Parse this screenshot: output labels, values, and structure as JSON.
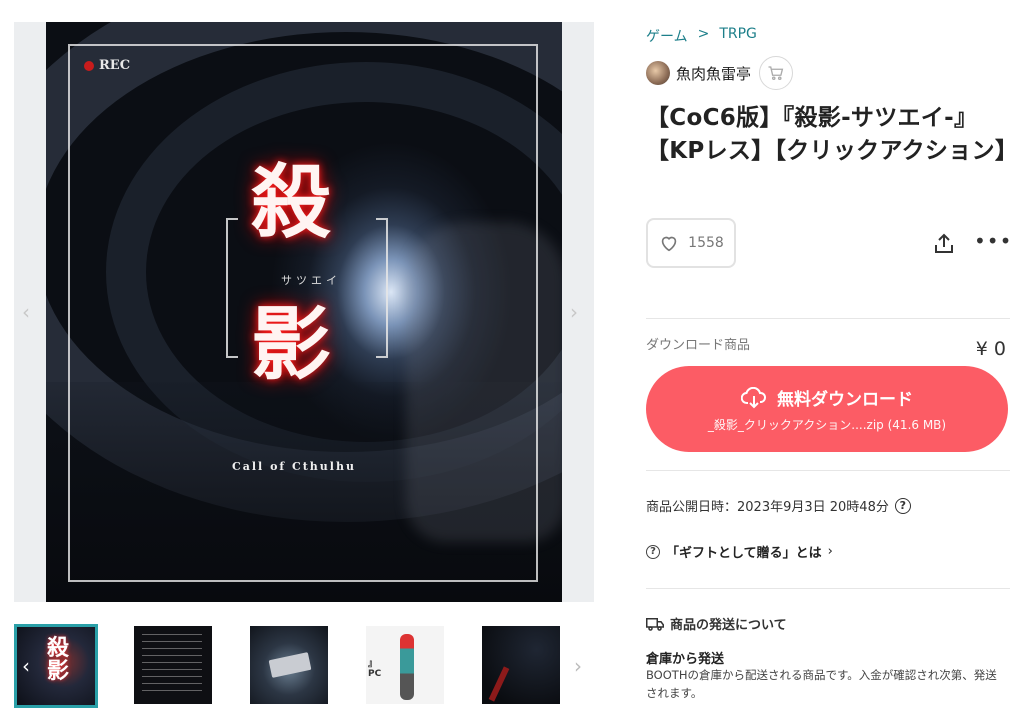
{
  "cover": {
    "rec_label": "REC",
    "kanji_top": "殺",
    "kanji_bottom": "影",
    "subtitle": "サツエイ",
    "game_label": "Call of Cthulhu"
  },
  "breadcrumb": {
    "category": "ゲーム",
    "sub_category": "TRPG"
  },
  "shop": {
    "name": "魚肉魚雷亭"
  },
  "product": {
    "title": "【CoC6版】『殺影-サツエイ-』【KPレス】【クリックアクション】",
    "likes": "1558",
    "type_label": "ダウンロード商品",
    "price": "¥ 0",
    "download_label": "無料ダウンロード",
    "download_file": "_殺影_クリックアクション....zip (41.6 MB)",
    "published": "商品公開日時：2023年9月3日 20時48分",
    "gift_label": "「ギフトとして贈る」とは"
  },
  "shipping": {
    "section_title": "商品の発送について",
    "method": "倉庫から発送",
    "description": "BOOTHの倉庫から配送される商品です。入金が確認され次第、発送されます。"
  },
  "thumbnails": {
    "thumb1_text": "殺\n影",
    "thumb4_text": "』\nPC"
  },
  "colors": {
    "accent": "#1d7f8a",
    "download": "#fc5c65",
    "thumb_border": "#2aa0a8"
  }
}
